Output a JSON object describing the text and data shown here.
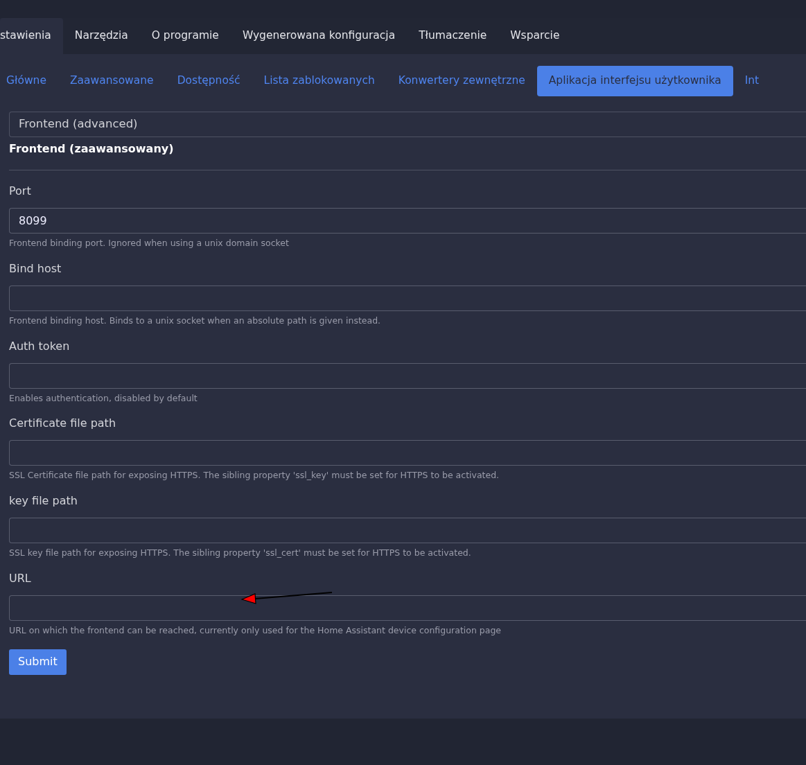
{
  "main_tabs": [
    {
      "label": "stawienia",
      "selected": true
    },
    {
      "label": "Narzędzia",
      "selected": false
    },
    {
      "label": "O programie",
      "selected": false
    },
    {
      "label": "Wygenerowana konfiguracja",
      "selected": false
    },
    {
      "label": "Tłumaczenie",
      "selected": false
    },
    {
      "label": "Wsparcie",
      "selected": false
    }
  ],
  "sub_tabs": [
    {
      "label": "Główne",
      "selected": false
    },
    {
      "label": "Zaawansowane",
      "selected": false
    },
    {
      "label": "Dostępność",
      "selected": false
    },
    {
      "label": "Lista zablokowanych",
      "selected": false
    },
    {
      "label": "Konwertery zewnętrzne",
      "selected": false
    },
    {
      "label": "Aplikacja interfejsu użytkownika",
      "selected": true
    },
    {
      "label": "Int",
      "selected": false
    }
  ],
  "section": {
    "header": "Frontend (advanced)",
    "title": "Frontend (zaawansowany)"
  },
  "fields": [
    {
      "label": "Port",
      "value": "8099",
      "help": "Frontend binding port. Ignored when using a unix domain socket"
    },
    {
      "label": "Bind host",
      "help": "Frontend binding host. Binds to a unix socket when an absolute path is given instead."
    },
    {
      "label": "Auth token",
      "help": "Enables authentication, disabled by default"
    },
    {
      "label": "Certificate file path",
      "help": "SSL Certificate file path for exposing HTTPS. The sibling property 'ssl_key' must be set for HTTPS to be activated."
    },
    {
      "label": "key file path",
      "help": "SSL key file path for exposing HTTPS. The sibling property 'ssl_cert' must be set for HTTPS to be activated."
    },
    {
      "label": "URL",
      "help": "URL on which the frontend can be reached, currently only used for the Home Assistant device configuration page",
      "annotated": true
    }
  ],
  "submit": "Submit"
}
